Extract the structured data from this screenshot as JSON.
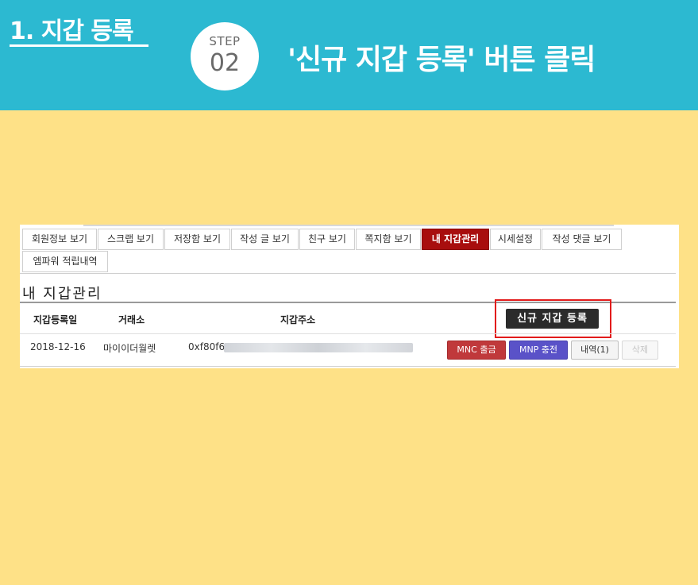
{
  "header": {
    "section_title": "1. 지갑 등록",
    "step_label": "STEP",
    "step_number": "02",
    "step_description": "'신규 지갑 등록' 버튼 클릭",
    "bg_color": "#2cb9d1"
  },
  "page_bg": "#fee187",
  "tabs": [
    {
      "label": "회원정보 보기",
      "active": false
    },
    {
      "label": "스크랩 보기",
      "active": false
    },
    {
      "label": "저장함 보기",
      "active": false
    },
    {
      "label": "작성 글 보기",
      "active": false
    },
    {
      "label": "친구 보기",
      "active": false
    },
    {
      "label": "쪽지함 보기",
      "active": false
    },
    {
      "label": "내 지갑관리",
      "active": true
    },
    {
      "label": "시세설정",
      "active": false
    },
    {
      "label": "작성 댓글 보기",
      "active": false
    },
    {
      "label": "엠파워 적립내역",
      "active": false
    }
  ],
  "wallet": {
    "heading": "내 지갑관리",
    "columns": {
      "date": "지갑등록일",
      "exchange": "거래소",
      "address": "지갑주소"
    },
    "register_button": "신규 지갑 등록",
    "row": {
      "date": "2018-12-16",
      "exchange": "마이이더월렛",
      "address_prefix": "0xf80f6"
    },
    "actions": {
      "withdraw": "MNC 출금",
      "charge": "MNP 충전",
      "history": "내역(1)",
      "delete": "삭제"
    }
  },
  "colors": {
    "active_tab": "#a80e0e",
    "highlight": "#e21b1b",
    "withdraw": "#c0393b",
    "charge": "#5a52c8"
  }
}
